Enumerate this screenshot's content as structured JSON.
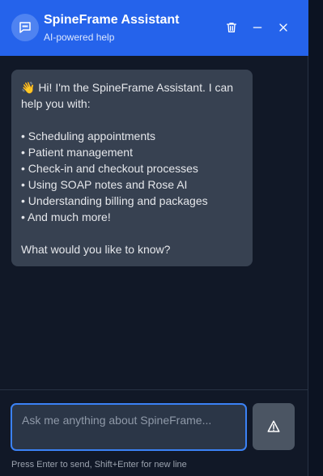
{
  "header": {
    "title": "SpineFrame Assistant",
    "subtitle": "AI-powered help",
    "icons": {
      "avatar": "chat-bubble-icon",
      "clear": "trash-icon",
      "minimize": "minus-icon",
      "close": "close-icon"
    }
  },
  "messages": [
    {
      "role": "assistant",
      "lines": [
        "👋 Hi! I'm the SpineFrame Assistant. I can",
        "help you with:",
        "",
        "• Scheduling appointments",
        "• Patient management",
        "• Check-in and checkout processes",
        "• Using SOAP notes and Rose AI",
        "• Understanding billing and packages",
        "• And much more!",
        "",
        "What would you like to know?"
      ]
    }
  ],
  "composer": {
    "placeholder": "Ask me anything about SpineFrame...",
    "value": "",
    "send_icon": "send-icon",
    "hint": "Press Enter to send, Shift+Enter for new line"
  },
  "colors": {
    "header_bg": "#2563eb",
    "panel_bg": "#111827",
    "bubble_bg": "#374151",
    "input_border": "#3b82f6",
    "send_bg": "#4b5563"
  }
}
